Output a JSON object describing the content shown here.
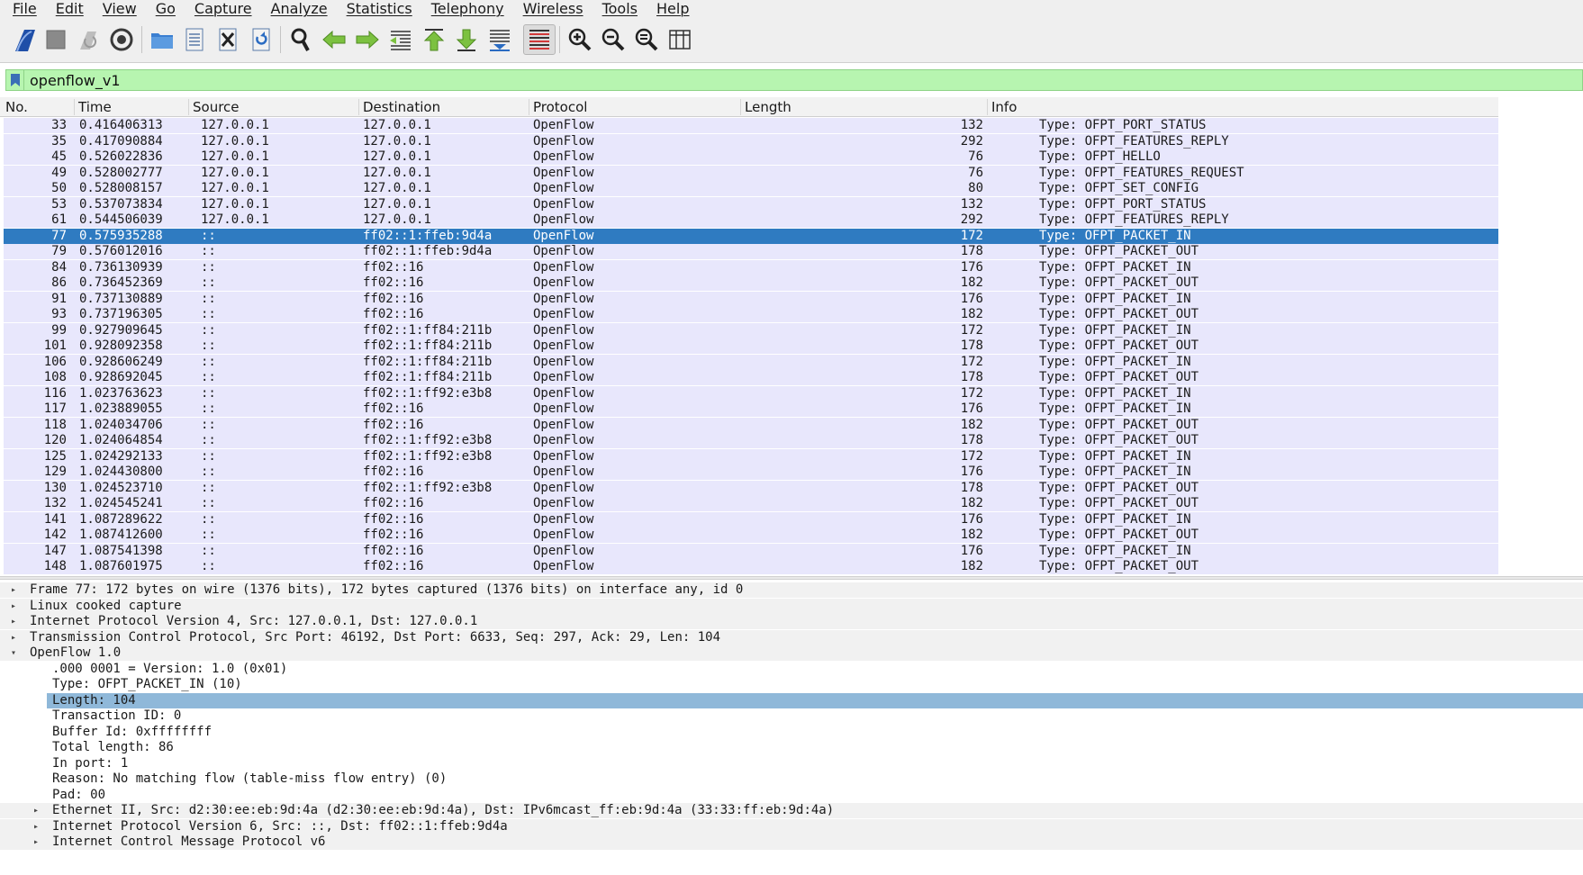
{
  "menu": [
    "File",
    "Edit",
    "View",
    "Go",
    "Capture",
    "Analyze",
    "Statistics",
    "Telephony",
    "Wireless",
    "Tools",
    "Help"
  ],
  "toolbar": {
    "buttons": [
      {
        "name": "start-capture-icon"
      },
      {
        "name": "stop-capture-icon"
      },
      {
        "name": "restart-capture-icon"
      },
      {
        "name": "capture-options-icon"
      },
      {
        "name": "open-file-icon"
      },
      {
        "name": "save-file-icon"
      },
      {
        "name": "close-file-icon"
      },
      {
        "name": "reload-file-icon"
      },
      {
        "name": "find-packet-icon"
      },
      {
        "name": "go-back-icon"
      },
      {
        "name": "go-forward-icon"
      },
      {
        "name": "go-to-packet-icon"
      },
      {
        "name": "go-first-packet-icon"
      },
      {
        "name": "go-last-packet-icon"
      },
      {
        "name": "auto-scroll-icon"
      },
      {
        "name": "colorize-icon"
      },
      {
        "name": "zoom-in-icon"
      },
      {
        "name": "zoom-out-icon"
      },
      {
        "name": "normal-size-icon"
      },
      {
        "name": "resize-columns-icon"
      }
    ]
  },
  "filter": {
    "value": "openflow_v1",
    "color": "#b7f5b0"
  },
  "columns": [
    "No.",
    "Time",
    "Source",
    "Destination",
    "Protocol",
    "Length",
    "Info"
  ],
  "colors": {
    "row_bg": "#e8e7fc",
    "selected_bg": "#2f7bc1",
    "detail_highlight": "#8fb8d9"
  },
  "packets": [
    {
      "no": "33",
      "time": "0.416406313",
      "src": "127.0.0.1",
      "dst": "127.0.0.1",
      "proto": "OpenFlow",
      "len": "132",
      "info": "Type: OFPT_PORT_STATUS"
    },
    {
      "no": "35",
      "time": "0.417090884",
      "src": "127.0.0.1",
      "dst": "127.0.0.1",
      "proto": "OpenFlow",
      "len": "292",
      "info": "Type: OFPT_FEATURES_REPLY"
    },
    {
      "no": "45",
      "time": "0.526022836",
      "src": "127.0.0.1",
      "dst": "127.0.0.1",
      "proto": "OpenFlow",
      "len": "76",
      "info": "Type: OFPT_HELLO"
    },
    {
      "no": "49",
      "time": "0.528002777",
      "src": "127.0.0.1",
      "dst": "127.0.0.1",
      "proto": "OpenFlow",
      "len": "76",
      "info": "Type: OFPT_FEATURES_REQUEST"
    },
    {
      "no": "50",
      "time": "0.528008157",
      "src": "127.0.0.1",
      "dst": "127.0.0.1",
      "proto": "OpenFlow",
      "len": "80",
      "info": "Type: OFPT_SET_CONFIG"
    },
    {
      "no": "53",
      "time": "0.537073834",
      "src": "127.0.0.1",
      "dst": "127.0.0.1",
      "proto": "OpenFlow",
      "len": "132",
      "info": "Type: OFPT_PORT_STATUS"
    },
    {
      "no": "61",
      "time": "0.544506039",
      "src": "127.0.0.1",
      "dst": "127.0.0.1",
      "proto": "OpenFlow",
      "len": "292",
      "info": "Type: OFPT_FEATURES_REPLY"
    },
    {
      "no": "77",
      "time": "0.575935288",
      "src": "::",
      "dst": "ff02::1:ffeb:9d4a",
      "proto": "OpenFlow",
      "len": "172",
      "info": "Type: OFPT_PACKET_IN",
      "selected": true
    },
    {
      "no": "79",
      "time": "0.576012016",
      "src": "::",
      "dst": "ff02::1:ffeb:9d4a",
      "proto": "OpenFlow",
      "len": "178",
      "info": "Type: OFPT_PACKET_OUT"
    },
    {
      "no": "84",
      "time": "0.736130939",
      "src": "::",
      "dst": "ff02::16",
      "proto": "OpenFlow",
      "len": "176",
      "info": "Type: OFPT_PACKET_IN"
    },
    {
      "no": "86",
      "time": "0.736452369",
      "src": "::",
      "dst": "ff02::16",
      "proto": "OpenFlow",
      "len": "182",
      "info": "Type: OFPT_PACKET_OUT"
    },
    {
      "no": "91",
      "time": "0.737130889",
      "src": "::",
      "dst": "ff02::16",
      "proto": "OpenFlow",
      "len": "176",
      "info": "Type: OFPT_PACKET_IN"
    },
    {
      "no": "93",
      "time": "0.737196305",
      "src": "::",
      "dst": "ff02::16",
      "proto": "OpenFlow",
      "len": "182",
      "info": "Type: OFPT_PACKET_OUT"
    },
    {
      "no": "99",
      "time": "0.927909645",
      "src": "::",
      "dst": "ff02::1:ff84:211b",
      "proto": "OpenFlow",
      "len": "172",
      "info": "Type: OFPT_PACKET_IN"
    },
    {
      "no": "101",
      "time": "0.928092358",
      "src": "::",
      "dst": "ff02::1:ff84:211b",
      "proto": "OpenFlow",
      "len": "178",
      "info": "Type: OFPT_PACKET_OUT"
    },
    {
      "no": "106",
      "time": "0.928606249",
      "src": "::",
      "dst": "ff02::1:ff84:211b",
      "proto": "OpenFlow",
      "len": "172",
      "info": "Type: OFPT_PACKET_IN"
    },
    {
      "no": "108",
      "time": "0.928692045",
      "src": "::",
      "dst": "ff02::1:ff84:211b",
      "proto": "OpenFlow",
      "len": "178",
      "info": "Type: OFPT_PACKET_OUT"
    },
    {
      "no": "116",
      "time": "1.023763623",
      "src": "::",
      "dst": "ff02::1:ff92:e3b8",
      "proto": "OpenFlow",
      "len": "172",
      "info": "Type: OFPT_PACKET_IN"
    },
    {
      "no": "117",
      "time": "1.023889055",
      "src": "::",
      "dst": "ff02::16",
      "proto": "OpenFlow",
      "len": "176",
      "info": "Type: OFPT_PACKET_IN"
    },
    {
      "no": "118",
      "time": "1.024034706",
      "src": "::",
      "dst": "ff02::16",
      "proto": "OpenFlow",
      "len": "182",
      "info": "Type: OFPT_PACKET_OUT"
    },
    {
      "no": "120",
      "time": "1.024064854",
      "src": "::",
      "dst": "ff02::1:ff92:e3b8",
      "proto": "OpenFlow",
      "len": "178",
      "info": "Type: OFPT_PACKET_OUT"
    },
    {
      "no": "125",
      "time": "1.024292133",
      "src": "::",
      "dst": "ff02::1:ff92:e3b8",
      "proto": "OpenFlow",
      "len": "172",
      "info": "Type: OFPT_PACKET_IN"
    },
    {
      "no": "129",
      "time": "1.024430800",
      "src": "::",
      "dst": "ff02::16",
      "proto": "OpenFlow",
      "len": "176",
      "info": "Type: OFPT_PACKET_IN"
    },
    {
      "no": "130",
      "time": "1.024523710",
      "src": "::",
      "dst": "ff02::1:ff92:e3b8",
      "proto": "OpenFlow",
      "len": "178",
      "info": "Type: OFPT_PACKET_OUT"
    },
    {
      "no": "132",
      "time": "1.024545241",
      "src": "::",
      "dst": "ff02::16",
      "proto": "OpenFlow",
      "len": "182",
      "info": "Type: OFPT_PACKET_OUT"
    },
    {
      "no": "141",
      "time": "1.087289622",
      "src": "::",
      "dst": "ff02::16",
      "proto": "OpenFlow",
      "len": "176",
      "info": "Type: OFPT_PACKET_IN"
    },
    {
      "no": "142",
      "time": "1.087412600",
      "src": "::",
      "dst": "ff02::16",
      "proto": "OpenFlow",
      "len": "182",
      "info": "Type: OFPT_PACKET_OUT"
    },
    {
      "no": "147",
      "time": "1.087541398",
      "src": "::",
      "dst": "ff02::16",
      "proto": "OpenFlow",
      "len": "176",
      "info": "Type: OFPT_PACKET_IN"
    },
    {
      "no": "148",
      "time": "1.087601975",
      "src": "::",
      "dst": "ff02::16",
      "proto": "OpenFlow",
      "len": "182",
      "info": "Type: OFPT_PACKET_OUT"
    }
  ],
  "details": [
    {
      "text": "Frame 77: 172 bytes on wire (1376 bits), 172 bytes captured (1376 bits) on interface any, id 0",
      "level": 0,
      "toggle": "collapsed",
      "shade": true
    },
    {
      "text": "Linux cooked capture",
      "level": 0,
      "toggle": "collapsed",
      "shade": true
    },
    {
      "text": "Internet Protocol Version 4, Src: 127.0.0.1, Dst: 127.0.0.1",
      "level": 0,
      "toggle": "collapsed",
      "shade": true
    },
    {
      "text": "Transmission Control Protocol, Src Port: 46192, Dst Port: 6633, Seq: 297, Ack: 29, Len: 104",
      "level": 0,
      "toggle": "collapsed",
      "shade": true
    },
    {
      "text": "OpenFlow 1.0",
      "level": 0,
      "toggle": "expanded",
      "shade": true
    },
    {
      "text": ".000 0001 = Version: 1.0 (0x01)",
      "level": 1,
      "toggle": "none"
    },
    {
      "text": "Type: OFPT_PACKET_IN (10)",
      "level": 1,
      "toggle": "none"
    },
    {
      "text": "Length: 104",
      "level": 1,
      "toggle": "none",
      "highlight": true
    },
    {
      "text": "Transaction ID: 0",
      "level": 1,
      "toggle": "none"
    },
    {
      "text": "Buffer Id: 0xffffffff",
      "level": 1,
      "toggle": "none"
    },
    {
      "text": "Total length: 86",
      "level": 1,
      "toggle": "none"
    },
    {
      "text": "In port: 1",
      "level": 1,
      "toggle": "none"
    },
    {
      "text": "Reason: No matching flow (table-miss flow entry) (0)",
      "level": 1,
      "toggle": "none"
    },
    {
      "text": "Pad: 00",
      "level": 1,
      "toggle": "none"
    },
    {
      "text": "Ethernet II, Src: d2:30:ee:eb:9d:4a (d2:30:ee:eb:9d:4a), Dst: IPv6mcast_ff:eb:9d:4a (33:33:ff:eb:9d:4a)",
      "level": 1,
      "toggle": "collapsed",
      "shade": true
    },
    {
      "text": "Internet Protocol Version 6, Src: ::, Dst: ff02::1:ffeb:9d4a",
      "level": 1,
      "toggle": "collapsed",
      "shade": true
    },
    {
      "text": "Internet Control Message Protocol v6",
      "level": 1,
      "toggle": "collapsed",
      "shade": true
    }
  ]
}
